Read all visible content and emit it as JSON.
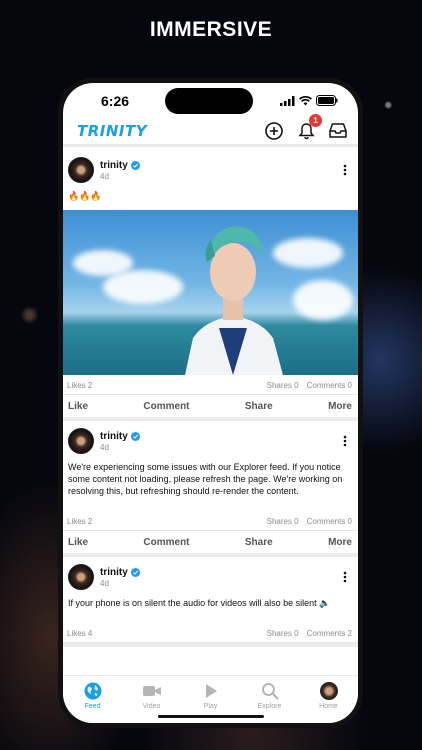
{
  "banner": {
    "title": "IMMERSIVE"
  },
  "status": {
    "time": "6:26"
  },
  "header": {
    "logo": "TRINITY",
    "notification_count": "1"
  },
  "posts": [
    {
      "author": "trinity",
      "age": "4d",
      "text": "🔥🔥🔥",
      "has_image": true,
      "likes": "Likes 2",
      "shares": "Shares 0",
      "comments": "Comments 0"
    },
    {
      "author": "trinity",
      "age": "4d",
      "text": "We're experiencing some issues with our Explorer feed. If you notice some content not loading, please refresh the page. We're working on resolving this, but refreshing should re-render the content.",
      "has_image": false,
      "likes": "Likes 2",
      "shares": "Shares 0",
      "comments": "Comments 0"
    },
    {
      "author": "trinity",
      "age": "4d",
      "text": "If your phone is on silent the audio for videos will also be silent 🔈",
      "has_image": false,
      "likes": "Likes 4",
      "shares": "Shares 0",
      "comments": "Comments 2"
    }
  ],
  "post_actions": {
    "like": "Like",
    "comment": "Comment",
    "share": "Share",
    "more": "More"
  },
  "tabs": [
    {
      "label": "Feed",
      "icon": "globe-icon",
      "active": true
    },
    {
      "label": "Video",
      "icon": "video-camera-icon",
      "active": false
    },
    {
      "label": "Play",
      "icon": "play-icon",
      "active": false
    },
    {
      "label": "Explore",
      "icon": "search-icon",
      "active": false
    },
    {
      "label": "Home",
      "icon": "profile-avatar-icon",
      "active": false
    }
  ],
  "colors": {
    "accent": "#1aa0e4",
    "badge": "#e53935",
    "verified": "#1d9bf0"
  }
}
